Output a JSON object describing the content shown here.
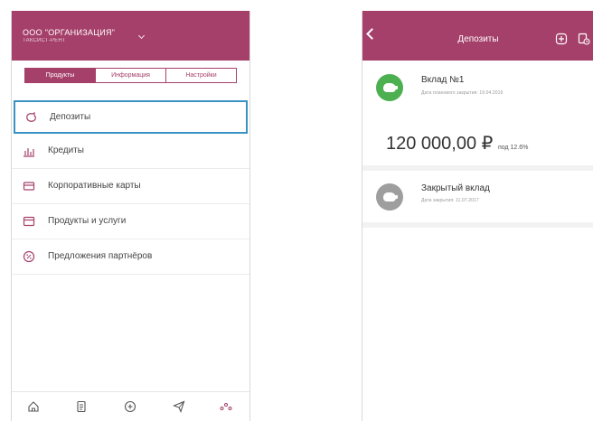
{
  "left": {
    "org_name": "ООО \"ОРГАНИЗАЦИЯ\"",
    "org_sub": "ТАКСИСТ-РЕНТ",
    "tabs": [
      "Продукты",
      "Информация",
      "Настройки"
    ],
    "active_tab": 0,
    "menu": [
      {
        "label": "Депозиты",
        "icon": "piggy-bank-icon",
        "highlighted": true
      },
      {
        "label": "Кредиты",
        "icon": "chart-icon"
      },
      {
        "label": "Корпоративные карты",
        "icon": "card-icon"
      },
      {
        "label": "Продукты и услуги",
        "icon": "wallet-icon"
      },
      {
        "label": "Предложения партнёров",
        "icon": "percent-icon"
      }
    ],
    "bottom_nav": [
      "home-icon",
      "document-icon",
      "plus-icon",
      "send-icon",
      "more-icon"
    ]
  },
  "right": {
    "title": "Депозиты",
    "deposit": {
      "title": "Вклад №1",
      "subtitle": "Дата планового закрытия: 19.04.2019",
      "amount": "120 000,00 ₽",
      "rate": "под 12.6%"
    },
    "closed": {
      "title": "Закрытый вклад",
      "subtitle": "Дата закрытия: 11.07.2017"
    }
  },
  "colors": {
    "brand": "#a5406a",
    "highlight": "#3a93c3",
    "active_coin": "#4caf50",
    "closed_coin": "#9e9e9e"
  }
}
